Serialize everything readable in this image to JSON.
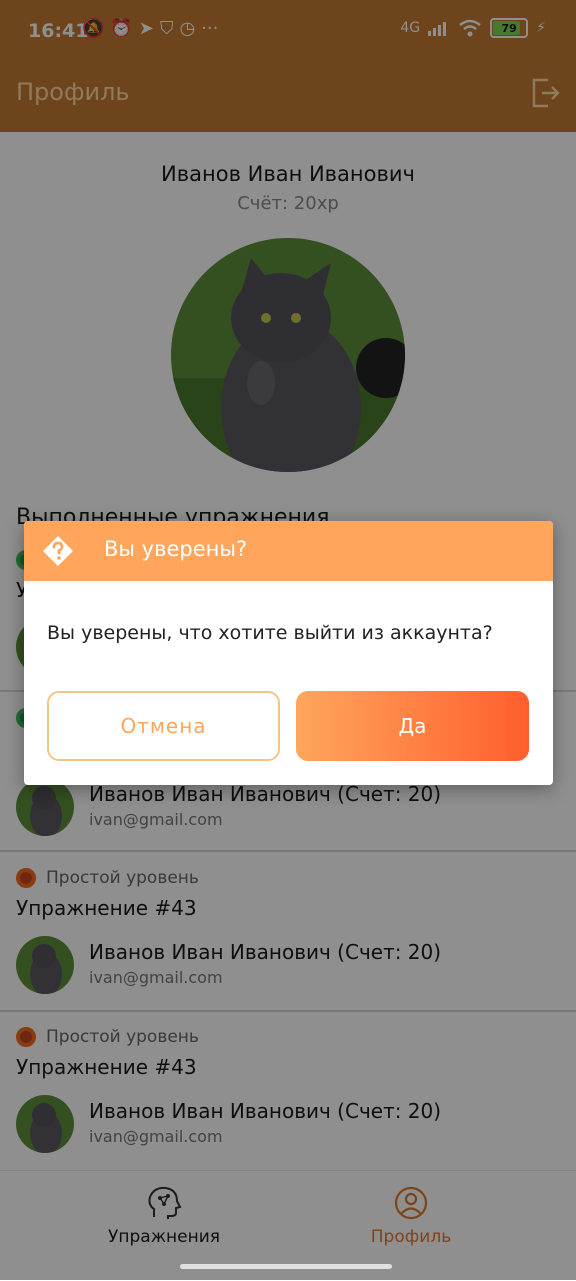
{
  "status_bar": {
    "time": "16:41",
    "network": "4G",
    "battery": "79",
    "icons": [
      "bell-off-icon",
      "alarm-icon",
      "telegram-icon",
      "shield-icon",
      "clock-icon",
      "more-icon"
    ]
  },
  "app_bar": {
    "title": "Профиль",
    "logout_icon": "logout-icon"
  },
  "profile": {
    "name": "Иванов Иван Иванович",
    "score": "Счёт: 20xp"
  },
  "section_title": "Выполненные упражнения",
  "exercises": [
    {
      "level": "Простой уровень",
      "name": "Упражнение #43",
      "user": "Иванов Иван Иванович (Счет: 20)",
      "email": "ivan@gmail.com"
    },
    {
      "level": "Простой уровень",
      "name": "Упражнение #43",
      "user": "Иванов Иван Иванович (Счет: 20)",
      "email": "ivan@gmail.com"
    }
  ],
  "dialog": {
    "title": "Вы уверены?",
    "message": "Вы уверены, что хотите выйти из аккаунта?",
    "cancel_label": "Отмена",
    "confirm_label": "Да"
  },
  "bottom_nav": {
    "items": [
      {
        "label": "Упражнения",
        "icon": "head-network-icon",
        "active": false
      },
      {
        "label": "Профиль",
        "icon": "user-circle-icon",
        "active": true
      }
    ]
  },
  "colors": {
    "app_bar": "#c27a31",
    "accent": "#ffa65c",
    "accent_dark": "#ff5e2b",
    "active_nav": "#e07a2e"
  }
}
